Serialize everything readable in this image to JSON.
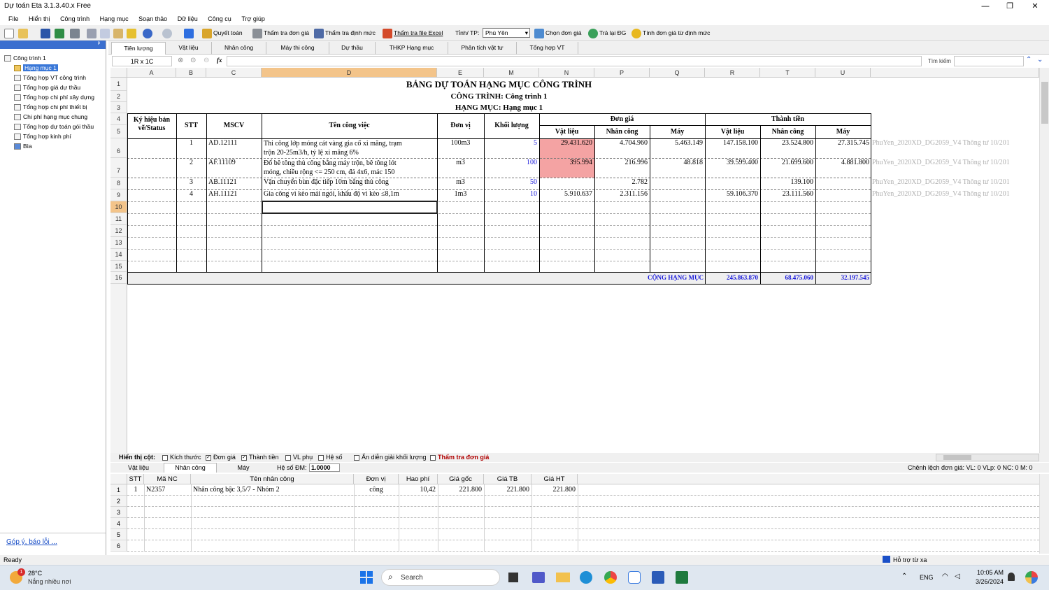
{
  "app": {
    "title": "Dự toán Eta 3.1.3.40.x Free",
    "minimize": "—",
    "maximize": "❐",
    "close": "✕"
  },
  "menu": [
    "File",
    "Hiển thị",
    "Công trình",
    "Hạng mục",
    "Soạn thảo",
    "Dữ liệu",
    "Công cụ",
    "Trợ giúp"
  ],
  "toolbar": {
    "quyet_toan": "Quyết toán",
    "tham_tra_don_gia": "Thẩm tra đơn giá",
    "tham_tra_dinh_muc": "Thẩm tra định mức",
    "tham_tra_file_excel": "Thẩm tra file Excel",
    "tinh_tp_label": "Tỉnh/ TP:",
    "tinh_tp_value": "Phú Yên",
    "chon_don_gia": "Chọn đơn giá",
    "tra_lai_dg": "Trả lại ĐG",
    "tinh_don_gia": "Tính đơn giá từ định mức"
  },
  "left": {
    "pin": "ᵖ",
    "feedback": "Góp ý, báo lỗi ...",
    "tree": [
      "Công trình 1",
      "Hạng mục 1",
      "Tổng hợp VT công trình",
      "Tổng hợp giá dự thầu",
      "Tổng hợp chi phí xây dựng",
      "Tổng hợp chi phí thiết bị",
      "Chi phí hạng mục chung",
      "Tổng hợp dự toán gói thầu",
      "Tổng hợp kinh phí",
      "Bìa"
    ]
  },
  "tabs": [
    "Tiên lượng",
    "Vật liệu",
    "Nhân công",
    "Máy thi công",
    "Dự thầu",
    "THKP Hạng mục",
    "Phân tích vật tư",
    "Tổng hợp VT"
  ],
  "formula": {
    "namebox": "1R x 1C",
    "fx": "fx",
    "search_label": "Tìm kiếm"
  },
  "columns": [
    "A",
    "B",
    "C",
    "D",
    "E",
    "M",
    "N",
    "P",
    "Q",
    "R",
    "T",
    "U"
  ],
  "rows": [
    "1",
    "2",
    "3",
    "4",
    "5",
    "6",
    "7",
    "8",
    "9",
    "10",
    "11",
    "12",
    "13",
    "14",
    "15",
    "16"
  ],
  "sheet": {
    "title": "BẢNG DỰ TOÁN HẠNG MỤC CÔNG TRÌNH",
    "cong_trinh": "CÔNG TRÌNH: Công trình 1",
    "hang_muc": "HẠNG MỤC: Hạng mục 1",
    "h_kyhieu1": "Ký hiệu bản",
    "h_kyhieu2": "vẽ/Status",
    "h_stt": "STT",
    "h_mscv": "MSCV",
    "h_ten": "Tên công việc",
    "h_donvi": "Đơn vị",
    "h_kl": "Khối lượng",
    "h_dongia": "Đơn giá",
    "h_thanhtien": "Thành tiền",
    "h_vl": "Vật liệu",
    "h_nc": "Nhân công",
    "h_may": "Máy",
    "items": [
      {
        "stt": "1",
        "mscv": "AD.12111",
        "ten1": "Thi công lớp móng cát vàng gia cố xi măng, trạm",
        "ten2": "trộn 20-25m3/h, tỷ lệ xi măng 6%",
        "dv": "100m3",
        "kl": "5",
        "vl": "29.431.620",
        "nc": "4.704.960",
        "may": "5.463.149",
        "ttvl": "147.158.100",
        "ttnc": "23.524.800",
        "ttmay": "27.315.745",
        "ref": "PhuYen_2020XD_DG2059_V4  Thông tư 10/201"
      },
      {
        "stt": "2",
        "mscv": "AF.11109",
        "ten1": "Đổ bê tông thủ công bằng máy trộn, bê tông lót",
        "ten2": "móng, chiều rộng <= 250 cm, đá 4x6, mác 150",
        "dv": "m3",
        "kl": "100",
        "vl": "395.994",
        "nc": "216.996",
        "may": "48.818",
        "ttvl": "39.599.400",
        "ttnc": "21.699.600",
        "ttmay": "4.881.800",
        "ref": "PhuYen_2020XD_DG2059_V4  Thông tư 10/201"
      },
      {
        "stt": "3",
        "mscv": "AB.11121",
        "ten1": "Vận chuyển bùn đặc tiếp 10m bằng thủ công",
        "ten2": "",
        "dv": "m3",
        "kl": "50",
        "vl": "",
        "nc": "2.782",
        "may": "",
        "ttvl": "",
        "ttnc": "139.100",
        "ttmay": "",
        "ref": "PhuYen_2020XD_DG2059_V4  Thông tư 10/201"
      },
      {
        "stt": "4",
        "mscv": "AH.11121",
        "ten1": "Gia công vì kèo mái ngói, khẩu độ vì kèo ≤8,1m",
        "ten2": "",
        "dv": "1m3",
        "kl": "10",
        "vl": "5.910.637",
        "nc": "2.311.156",
        "may": "",
        "ttvl": "59.106.370",
        "ttnc": "23.111.560",
        "ttmay": "",
        "ref": "PhuYen_2020XD_DG2059_V4  Thông tư 10/201"
      }
    ],
    "total_label": "CỘNG HẠNG MỤC",
    "total_vl": "245.863.870",
    "total_nc": "68.475.060",
    "total_may": "32.197.545"
  },
  "options": {
    "label": "Hiển thị cột:",
    "items": [
      {
        "t": "Kích thước",
        "c": false
      },
      {
        "t": "Đơn giá",
        "c": true
      },
      {
        "t": "Thành tiền",
        "c": true
      },
      {
        "t": "VL phụ",
        "c": false
      },
      {
        "t": "Hệ số",
        "c": false
      },
      {
        "t": "Ẩn diễn giải khối lượng",
        "c": false
      }
    ],
    "tham_tra": "Thẩm tra đơn giá"
  },
  "subtabs": [
    "Vật liệu",
    "Nhân công",
    "Máy"
  ],
  "heso_label": "Hệ số ĐM:",
  "heso_value": "1.0000",
  "chenh_lech": "Chênh lệch đơn giá: VL: 0   VLp: 0   NC: 0   M: 0",
  "subgrid": {
    "headers": [
      "STT",
      "Mã NC",
      "Tên nhân công",
      "Đơn vị",
      "Hao phí",
      "Giá gốc",
      "Giá TB",
      "Giá HT"
    ],
    "row": [
      "1",
      "N2357",
      "Nhân công bậc 3,5/7 - Nhóm 2",
      "công",
      "10,42",
      "221.800",
      "221.800",
      "221.800"
    ],
    "rownums": [
      "1",
      "2",
      "3",
      "4",
      "5",
      "6"
    ]
  },
  "status": {
    "ready": "Ready",
    "help": "Hỗ trợ từ xa"
  },
  "taskbar": {
    "temp": "28°C",
    "weather": "Nắng nhiều nơi",
    "search": "Search",
    "lang": "ENG",
    "time": "10:05 AM",
    "date": "3/26/2024",
    "badge": "1"
  }
}
